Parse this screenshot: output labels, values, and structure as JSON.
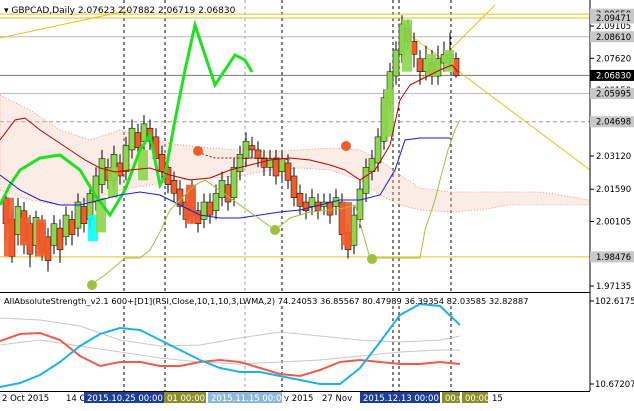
{
  "main_header": {
    "symbol": "GBPCAD,Daily",
    "ohlc": "2.07623 2.07882 2.06719 2.06830"
  },
  "sub_header": {
    "text": "AllAbsoluteStrength_v2.1 600+[D1](RSI,Close,10,1,10,3,LWMA,2) 74.24053 36.85567 80.47989 36.39354 82.03585 32.82887"
  },
  "colors": {
    "price_up": "#8bd64a",
    "price_down": "#f25c2a",
    "dark_candle": "#000000",
    "green_line": "#1ee21e",
    "olive_line": "#9bc43b",
    "blue_line": "#1a1ad6",
    "red_line": "#c00000",
    "cloud": "#f08060",
    "yellow_line": "#e8c020",
    "cyan": "#00ffff",
    "strength_blue": "#1fb1e6",
    "strength_red": "#ef5b4b",
    "strength_gray": "#c8c8c8"
  },
  "price_axis": {
    "ticks": [
      "2.09105",
      "2.07620",
      "2.06150",
      "2.04680",
      "2.03120",
      "2.01590",
      "2.00105",
      "1.98476",
      "1.97135"
    ],
    "highlight_labels": [
      {
        "text": "2.09650",
        "value": 2.0965,
        "style": "gray"
      },
      {
        "text": "2.09471",
        "value": 2.09471,
        "style": "gray"
      },
      {
        "text": "2.08610",
        "value": 2.0861,
        "style": "gray"
      },
      {
        "text": "2.06830",
        "value": 2.0683,
        "style": "dark"
      },
      {
        "text": "2.05995",
        "value": 2.05995,
        "style": "gray"
      },
      {
        "text": "2.04698",
        "value": 2.04698,
        "style": "gray"
      },
      {
        "text": "1.98476",
        "value": 1.98476,
        "style": "gray"
      }
    ]
  },
  "sub_axis": {
    "ticks": [
      "102.6175",
      "10.67207"
    ]
  },
  "time_axis": {
    "labels": [
      "2 Oct 2015",
      "14 O",
      "v 2015",
      "27 Nov",
      "15"
    ],
    "highlighted": [
      {
        "text": "2015.10.25 00:00",
        "style": "blue"
      },
      {
        "text": "01 00:00",
        "style": "olive"
      },
      {
        "text": "2015.11.15 00:00",
        "style": "lightblue"
      },
      {
        "text": "2015.12.13 00:00",
        "style": "blue"
      },
      {
        "text": "00:0",
        "style": "olive"
      },
      {
        "text": "00:00",
        "style": "olive"
      }
    ]
  }
}
